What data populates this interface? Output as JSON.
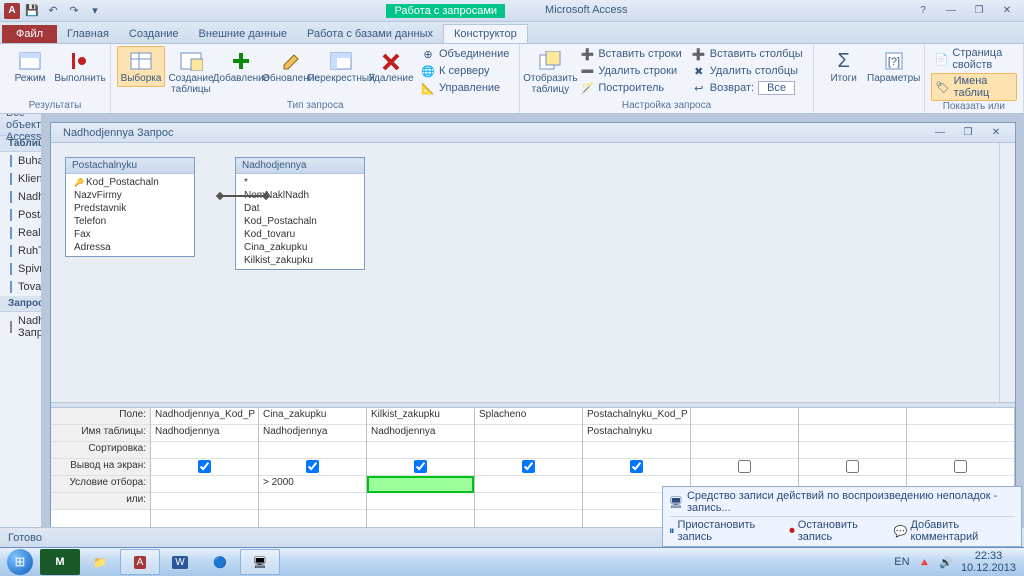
{
  "app": {
    "title": "Microsoft Access",
    "context_tab": "Работа с запросами"
  },
  "qat": [
    "💾",
    "↶",
    "↷"
  ],
  "tabs": {
    "file": "Файл",
    "items": [
      "Главная",
      "Создание",
      "Внешние данные",
      "Работа с базами данных",
      "Конструктор"
    ],
    "active": 4
  },
  "ribbon": {
    "g1": {
      "label": "Результаты",
      "view": "Режим",
      "run": "Выполнить"
    },
    "g2": {
      "label": "Тип запроса",
      "select": "Выборка",
      "make": "Создание таблицы",
      "append": "Добавление",
      "update": "Обновление",
      "crosstab": "Перекрестный",
      "delete": "Удаление",
      "union": "Объединение",
      "passthrough": "К серверу",
      "datadef": "Управление"
    },
    "g3": {
      "label": "Настройка запроса",
      "show": "Отобразить таблицу",
      "ins_rows": "Вставить строки",
      "del_rows": "Удалить строки",
      "builder": "Построитель",
      "ins_cols": "Вставить столбцы",
      "del_cols": "Удалить столбцы",
      "return_lbl": "Возврат:",
      "return_val": "Все"
    },
    "g4": {
      "totals": "Итоги",
      "params": "Параметры"
    },
    "g5": {
      "label": "Показать или скрыть",
      "prop": "Страница свойств",
      "names": "Имена таблиц"
    }
  },
  "nav": {
    "header": "Все объекты Access",
    "sec_tables": "Таблицы",
    "tables": [
      "Buhalteriya",
      "Klienty",
      "Nadhodjennya",
      "Postachalnyku",
      "Realizaciya",
      "RuhTovary",
      "Spivrobitnuku",
      "Tovary"
    ],
    "sec_queries": "Запросы",
    "queries": [
      "Nadhodjennya Запрос"
    ]
  },
  "subwin": {
    "title": "Nadhodjennya Запрос",
    "t1": {
      "name": "Postachalnyku",
      "fields": [
        "Kod_Postachaln",
        "NazvFirmy",
        "Predstavnik",
        "Telefon",
        "Fax",
        "Adressa"
      ],
      "key": 0
    },
    "t2": {
      "name": "Nadhodjennya",
      "fields": [
        "*",
        "NomNaklNadh",
        "Dat",
        "Kod_Postachaln",
        "Kod_tovaru",
        "Cina_zakupku",
        "Kilkist_zakupku"
      ]
    }
  },
  "grid": {
    "rowlabels": [
      "Поле:",
      "Имя таблицы:",
      "Сортировка:",
      "Вывод на экран:",
      "Условие отбора:",
      "или:"
    ],
    "cols": [
      {
        "field": "Nadhodjennya_Kod_P",
        "table": "Nadhodjennya",
        "show": true,
        "crit": ""
      },
      {
        "field": "Cina_zakupku",
        "table": "Nadhodjennya",
        "show": true,
        "crit": "> 2000"
      },
      {
        "field": "Kilkist_zakupku",
        "table": "Nadhodjennya",
        "show": true,
        "crit": "",
        "active": true
      },
      {
        "field": "Splacheno",
        "table": "",
        "show": true,
        "crit": ""
      },
      {
        "field": "Postachalnyku_Kod_P",
        "table": "Postachalnyku",
        "show": true,
        "crit": ""
      },
      {
        "field": "",
        "table": "",
        "show": false,
        "crit": ""
      },
      {
        "field": "",
        "table": "",
        "show": false,
        "crit": ""
      },
      {
        "field": "",
        "table": "",
        "show": false,
        "crit": ""
      }
    ]
  },
  "statusbar": {
    "ready": "Готово"
  },
  "psr": {
    "title": "Средство записи действий по воспроизведению неполадок - запись...",
    "pause": "Приостановить запись",
    "stop": "Остановить запись",
    "comment": "Добавить комментарий"
  },
  "tray": {
    "lang": "EN",
    "time": "22:33",
    "date": "10.12.2013"
  }
}
